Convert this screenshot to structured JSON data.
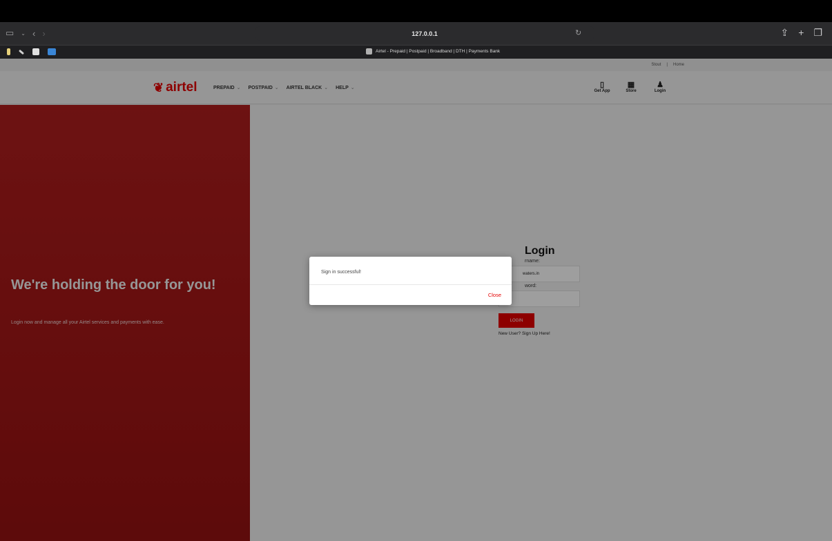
{
  "browser": {
    "url": "127.0.0.1",
    "tab_title": "Airtel - Prepaid | Postpaid | Broadband | DTH | Payments Bank",
    "back_icon": "chevron-left-icon",
    "forward_icon": "chevron-right-icon"
  },
  "header": {
    "utility_links": [
      "Stout",
      "Home"
    ],
    "brand": "airtel",
    "menu": [
      {
        "label": "PREPAID"
      },
      {
        "label": "POSTPAID"
      },
      {
        "label": "AIRTEL BLACK"
      },
      {
        "label": "HELP"
      }
    ],
    "actions": [
      {
        "label": "Get App",
        "icon": "phone-icon"
      },
      {
        "label": "Store",
        "icon": "store-icon"
      },
      {
        "label": "Login",
        "icon": "user-icon"
      }
    ]
  },
  "hero": {
    "title": "We're holding the door for you!",
    "subtitle": "Login now and manage all your Airtel services and payments with ease."
  },
  "login": {
    "title": "Login",
    "username_label": "rname:",
    "username_value": "waters.in",
    "password_label": "word:",
    "password_value": "••••••",
    "button": "LOGIN",
    "signup": "New User? Sign Up Here!"
  },
  "modal": {
    "message": "Sign in successful!",
    "close": "Close"
  },
  "colors": {
    "brand_red": "#e40000",
    "hero_red": "#a31616"
  }
}
